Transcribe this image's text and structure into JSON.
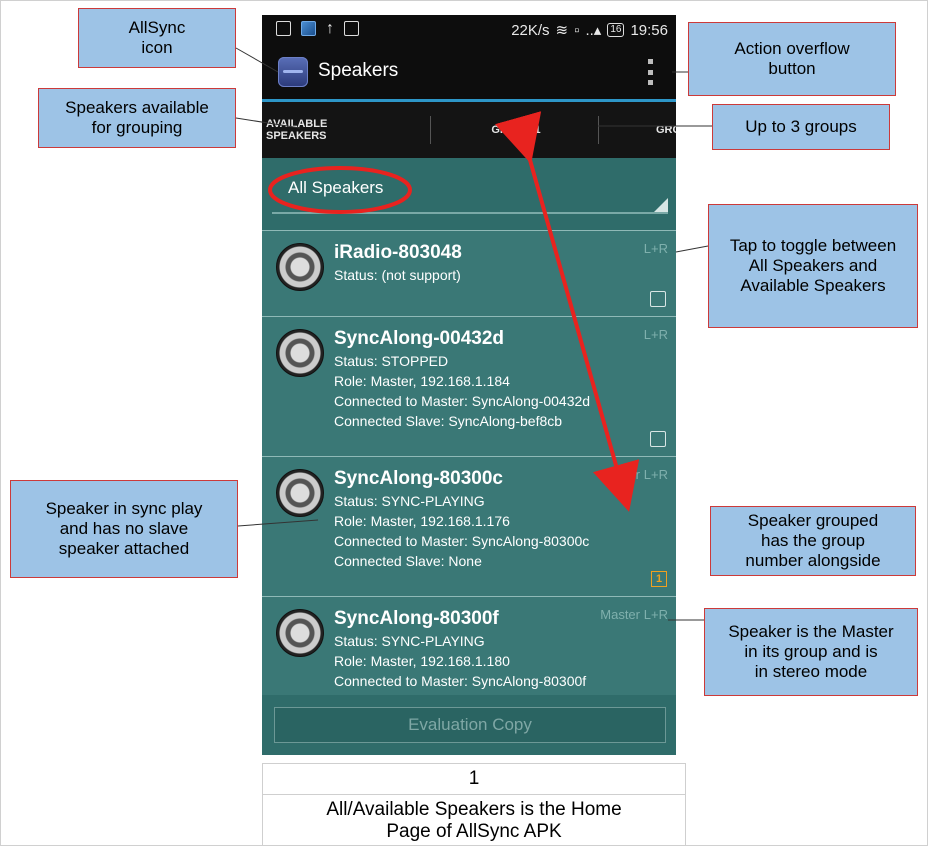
{
  "status_bar": {
    "speed": "22K/s",
    "battery": "16",
    "time": "19:56"
  },
  "app": {
    "title": "Speakers",
    "icon": "allsync-app-icon"
  },
  "tabs": [
    {
      "label": "AVAILABLE\nSPEAKERS",
      "selected": true
    },
    {
      "label": "GROUP 1",
      "selected": false
    },
    {
      "label": "GRO",
      "selected": false
    }
  ],
  "filter": {
    "value": "All Speakers"
  },
  "speakers": [
    {
      "name": "iRadio-803048",
      "lines": [
        "Status: (not support)"
      ],
      "role_tag": "",
      "mode": "L+R",
      "indicator": "checkbox"
    },
    {
      "name": "SyncAlong-00432d",
      "lines": [
        "Status: STOPPED",
        "Role: Master,  192.168.1.184",
        "Connected to Master: SyncAlong-00432d",
        "Connected Slave: SyncAlong-bef8cb"
      ],
      "role_tag": "",
      "mode": "L+R",
      "indicator": "checkbox"
    },
    {
      "name": "SyncAlong-80300c",
      "lines": [
        "Status: SYNC-PLAYING",
        "Role: Master,  192.168.1.176",
        "Connected to Master: SyncAlong-80300c",
        "Connected Slave: None"
      ],
      "role_tag": "Master",
      "mode": "L+R",
      "indicator": "group",
      "group": "1"
    },
    {
      "name": "SyncAlong-80300f",
      "lines": [
        "Status: SYNC-PLAYING",
        "Role: Master,  192.168.1.180",
        "Connected to Master: SyncAlong-80300f"
      ],
      "role_tag": "Master",
      "mode": "L+R",
      "indicator": "dash"
    }
  ],
  "evaluation_button": "Evaluation Copy",
  "callouts": {
    "allsync_icon": "AllSync\nicon",
    "available_for_grouping": "Speakers available\nfor grouping",
    "action_overflow": "Action overflow\nbutton",
    "up_to_3_groups": "Up to 3 groups",
    "tap_to_toggle": "Tap to toggle between\nAll Speakers and\nAvailable Speakers",
    "sync_play_no_slave": "Speaker in sync play\nand has no slave\nspeaker attached",
    "grouped_number": "Speaker grouped\nhas the group\nnumber alongside",
    "master_stereo": "Speaker is the Master\nin its group and is\nin stereo mode"
  },
  "caption": {
    "number": "1",
    "text": "All/Available Speakers is the Home\nPage of AllSync APK"
  },
  "colors": {
    "accent": "#2d96c8",
    "list_bg": "#3a7876",
    "callout_fill": "#9dc3e6",
    "arrow_red": "#e8231f",
    "group_badge": "#f0a020"
  }
}
